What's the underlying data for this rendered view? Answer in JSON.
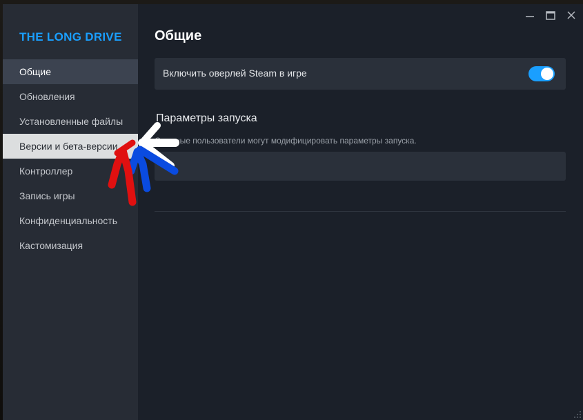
{
  "window": {
    "controls": {
      "minimize_icon": "minimize-icon",
      "maximize_icon": "maximize-icon",
      "close_icon": "close-icon"
    }
  },
  "sidebar": {
    "game_title": "THE LONG DRIVE",
    "items": [
      {
        "label": "Общие",
        "state": "active"
      },
      {
        "label": "Обновления",
        "state": "normal"
      },
      {
        "label": "Установленные файлы",
        "state": "normal"
      },
      {
        "label": "Версии и бета-версии",
        "state": "hover"
      },
      {
        "label": "Контроллер",
        "state": "normal"
      },
      {
        "label": "Запись игры",
        "state": "normal"
      },
      {
        "label": "Конфиденциальность",
        "state": "normal"
      },
      {
        "label": "Кастомизация",
        "state": "normal"
      }
    ]
  },
  "main": {
    "title": "Общие",
    "overlay_setting": {
      "label": "Включить оверлей Steam в игре",
      "enabled": true
    },
    "launch_options": {
      "heading": "Параметры запуска",
      "hint": "Опытные пользователи могут модифицировать параметры запуска.",
      "value": ""
    }
  },
  "colors": {
    "accent": "#1a9fff",
    "sidebar_bg": "#272c35",
    "content_bg": "#1b2029",
    "annotation_white": "#ffffff",
    "annotation_blue": "#0a4be0",
    "annotation_red": "#e01010"
  }
}
